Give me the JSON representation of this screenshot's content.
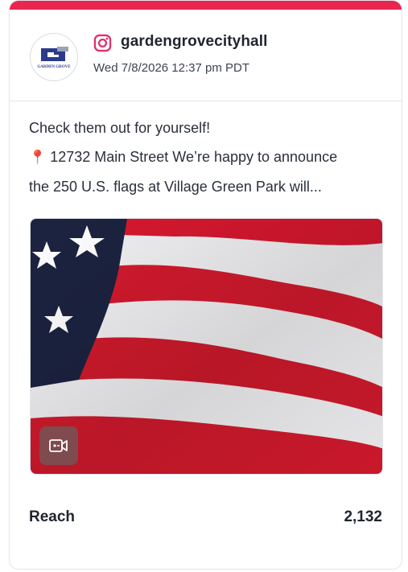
{
  "post": {
    "account": {
      "username": "gardengrovecityhall",
      "avatar_text": "GARDEN GROVE",
      "avatar_letter": "G",
      "network_icon": "instagram-icon",
      "network_color": "#e1306c"
    },
    "timestamp": "Wed 7/8/2026 12:37 pm PDT",
    "caption": {
      "line1": "Check them out for yourself!",
      "line2_icon": "📍",
      "line2": "12732 Main Street We’re happy to announce",
      "line3": "the 250 U.S. flags at Village Green Park will..."
    },
    "media": {
      "type": "video",
      "description_icon": "video-icon"
    },
    "stats": {
      "reach_label": "Reach",
      "reach_value": "2,132"
    }
  },
  "colors": {
    "accent_bar": "#e8264f",
    "text": "#1f2430",
    "border": "#e3e5e9"
  }
}
